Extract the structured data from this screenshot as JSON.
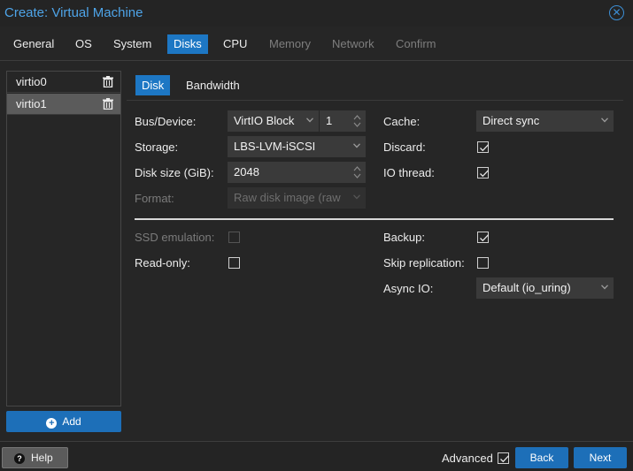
{
  "dialog": {
    "title": "Create: Virtual Machine"
  },
  "tabs": [
    {
      "label": "General",
      "state": "enabled"
    },
    {
      "label": "OS",
      "state": "enabled"
    },
    {
      "label": "System",
      "state": "enabled"
    },
    {
      "label": "Disks",
      "state": "active"
    },
    {
      "label": "CPU",
      "state": "enabled"
    },
    {
      "label": "Memory",
      "state": "disabled"
    },
    {
      "label": "Network",
      "state": "disabled"
    },
    {
      "label": "Confirm",
      "state": "disabled"
    }
  ],
  "disks": {
    "items": [
      {
        "label": "virtio0",
        "selected": false
      },
      {
        "label": "virtio1",
        "selected": true
      }
    ],
    "add_label": "Add"
  },
  "subtabs": [
    {
      "label": "Disk",
      "active": true
    },
    {
      "label": "Bandwidth",
      "active": false
    }
  ],
  "form": {
    "bus_device": {
      "label": "Bus/Device:",
      "bus": "VirtIO Block",
      "device": "1"
    },
    "storage": {
      "label": "Storage:",
      "value": "LBS-LVM-iSCSI"
    },
    "disk_size": {
      "label": "Disk size (GiB):",
      "value": "2048"
    },
    "format": {
      "label": "Format:",
      "value": "Raw disk image (raw",
      "disabled": true
    },
    "cache": {
      "label": "Cache:",
      "value": "Direct sync"
    },
    "discard": {
      "label": "Discard:",
      "checked": true
    },
    "io_thread": {
      "label": "IO thread:",
      "checked": true
    },
    "ssd_emulation": {
      "label": "SSD emulation:",
      "checked": false,
      "disabled": true
    },
    "read_only": {
      "label": "Read-only:",
      "checked": false
    },
    "backup": {
      "label": "Backup:",
      "checked": true
    },
    "skip_replication": {
      "label": "Skip replication:",
      "checked": false
    },
    "async_io": {
      "label": "Async IO:",
      "value": "Default (io_uring)"
    }
  },
  "footer": {
    "help_label": "Help",
    "advanced_label": "Advanced",
    "advanced_checked": true,
    "back_label": "Back",
    "next_label": "Next"
  }
}
